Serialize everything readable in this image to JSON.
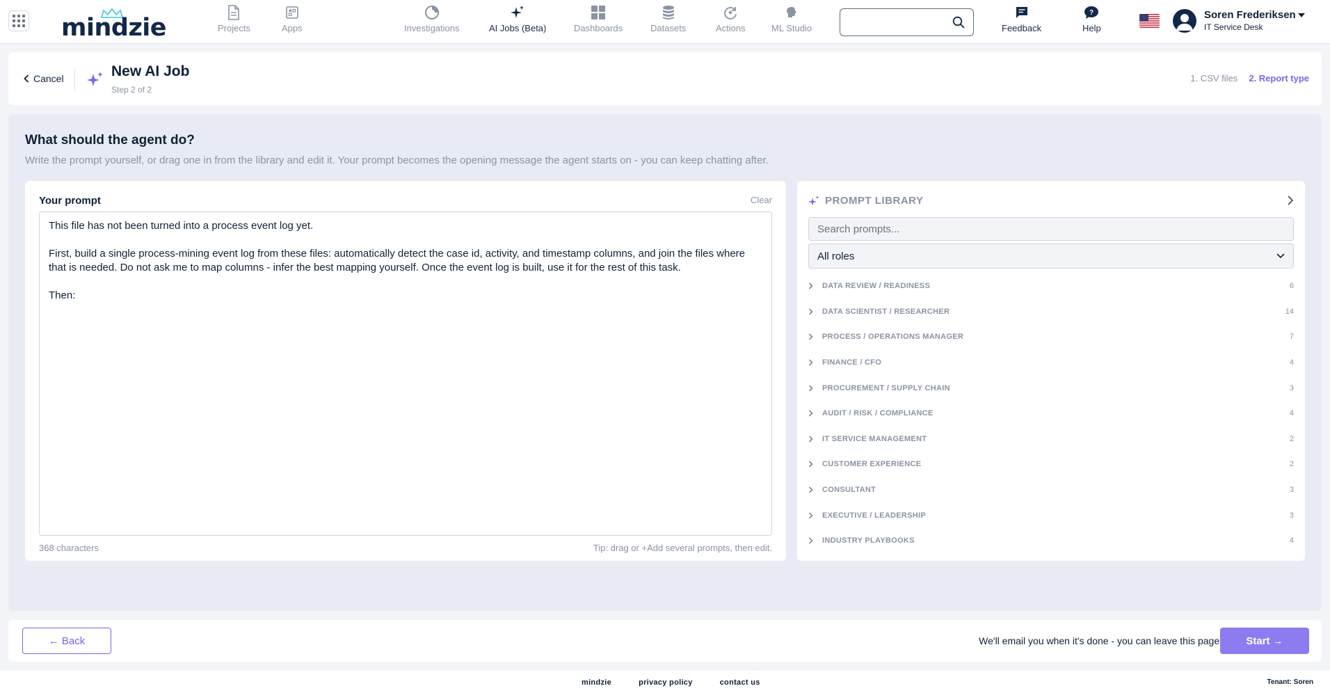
{
  "nav": {
    "brand": "mindzie",
    "items": [
      {
        "id": "projects",
        "label": "Projects",
        "icon": "document-icon"
      },
      {
        "id": "apps",
        "label": "Apps",
        "icon": "app-icon"
      },
      {
        "id": "investigations",
        "label": "Investigations",
        "icon": "pie-chart-icon"
      },
      {
        "id": "ai-jobs",
        "label": "AI Jobs (Beta)",
        "icon": "sparkle-icon",
        "active": true
      },
      {
        "id": "dashboards",
        "label": "Dashboards",
        "icon": "grid-icon"
      },
      {
        "id": "datasets",
        "label": "Datasets",
        "icon": "database-icon"
      },
      {
        "id": "actions",
        "label": "Actions",
        "icon": "refresh-icon"
      },
      {
        "id": "ml-studio",
        "label": "ML Studio",
        "icon": "brain-icon"
      }
    ],
    "search": {
      "value": "",
      "placeholder": ""
    },
    "feedback_label": "Feedback",
    "help_label": "Help",
    "user": {
      "name": "Soren Frederiksen",
      "dept": "IT Service Desk"
    }
  },
  "header": {
    "cancel_label": "Cancel",
    "title": "New AI Job",
    "step": "Step 2 of 2",
    "steps": [
      "1. CSV files",
      "2. Report type"
    ]
  },
  "main": {
    "question": "What should the agent do?",
    "subtitle": "Write the prompt yourself, or drag one in from the library and edit it. Your prompt becomes the opening message the agent starts on - you can keep chatting after.",
    "prompt": {
      "label": "Your prompt",
      "clear_label": "Clear",
      "text": "This file has not been turned into a process event log yet.\n\nFirst, build a single process-mining event log from these files: automatically detect the case id, activity, and timestamp columns, and join the files where that is needed. Do not ask me to map columns - infer the best mapping yourself. Once the event log is built, use it for the rest of this task.\n\nThen:",
      "char_count": "368 characters",
      "tip": "Tip: drag or +Add several prompts, then edit."
    },
    "library": {
      "title": "PROMPT LIBRARY",
      "search_placeholder": "Search prompts...",
      "role_selected": "All roles",
      "categories": [
        {
          "name": "DATA REVIEW / READINESS",
          "count": "6"
        },
        {
          "name": "DATA SCIENTIST / RESEARCHER",
          "count": "14"
        },
        {
          "name": "PROCESS / OPERATIONS MANAGER",
          "count": "7"
        },
        {
          "name": "FINANCE / CFO",
          "count": "4"
        },
        {
          "name": "PROCUREMENT / SUPPLY CHAIN",
          "count": "3"
        },
        {
          "name": "AUDIT / RISK / COMPLIANCE",
          "count": "4"
        },
        {
          "name": "IT SERVICE MANAGEMENT",
          "count": "2"
        },
        {
          "name": "CUSTOMER EXPERIENCE",
          "count": "2"
        },
        {
          "name": "CONSULTANT",
          "count": "3"
        },
        {
          "name": "EXECUTIVE / LEADERSHIP",
          "count": "3"
        },
        {
          "name": "INDUSTRY PLAYBOOKS",
          "count": "4"
        }
      ]
    }
  },
  "actions": {
    "back_label": "← Back",
    "email_note": "We'll email you when it's done - you can leave this page.",
    "start_label": "Start →"
  },
  "footer": {
    "links": [
      "mindzie",
      "privacy policy",
      "contact us"
    ],
    "tenant": "Tenant: Soren"
  },
  "colors": {
    "accent": "#7a66e6",
    "navy": "#0f2138",
    "muted": "#8a93a3"
  }
}
